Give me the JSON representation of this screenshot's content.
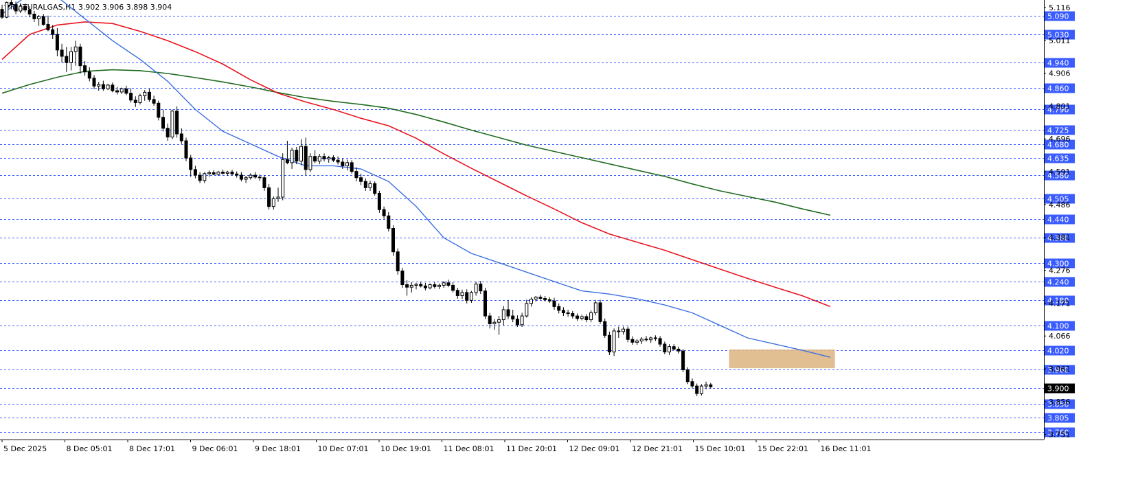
{
  "header": {
    "symbol": "NATURALGAS",
    "timeframe": "H1",
    "ohlc": "3.902 3.906 3.898 3.904",
    "ticker_text": "NATURALGAS,H1  3.902 3.906 3.898 3.904"
  },
  "colors": {
    "background": "#ffffff",
    "bullet_level": "#3a5cff",
    "candle": "#000000",
    "ma_fast": "#3b6fe0",
    "ma_mid": "#e8141e",
    "ma_slow": "#1f6b1f",
    "zone": "#deb887",
    "axis_text": "#000000",
    "price_tag_blue_bg": "#3a5cff",
    "price_tag_black_bg": "#000000"
  },
  "chart_data": {
    "type": "candlestick",
    "symbol": "NATURALGAS",
    "timeframe": "H1",
    "ylim": [
      3.735,
      5.14
    ],
    "y_ticks": [
      "5.116",
      "5.011",
      "4.906",
      "4.801",
      "4.696",
      "4.591",
      "4.486",
      "4.381",
      "4.276",
      "4.171",
      "4.066",
      "3.961",
      "3.856",
      "3.751"
    ],
    "x_ticks": [
      "5 Dec 2025",
      "8 Dec 05:01",
      "8 Dec 17:01",
      "9 Dec 06:01",
      "9 Dec 18:01",
      "10 Dec 07:01",
      "10 Dec 19:01",
      "11 Dec 08:01",
      "11 Dec 20:01",
      "12 Dec 09:01",
      "12 Dec 21:01",
      "15 Dec 10:01",
      "15 Dec 22:01",
      "16 Dec 11:01"
    ],
    "levels": [
      "5.090",
      "5.030",
      "4.940",
      "4.860",
      "4.790",
      "4.725",
      "4.680",
      "4.635",
      "4.580",
      "4.505",
      "4.440",
      "4.380",
      "4.300",
      "4.240",
      "4.180",
      "4.100",
      "4.020",
      "3.960",
      "3.900",
      "3.850",
      "3.805",
      "3.760"
    ],
    "current_price": "3.900",
    "highlight_zone": {
      "from_price": 3.963,
      "to_price": 4.023,
      "start_bar": 158,
      "end_bar": 181
    },
    "candles": [
      [
        5.11,
        5.125,
        5.08,
        5.085
      ],
      [
        5.085,
        5.135,
        5.082,
        5.132
      ],
      [
        5.132,
        5.14,
        5.11,
        5.125
      ],
      [
        5.125,
        5.135,
        5.095,
        5.105
      ],
      [
        5.105,
        5.13,
        5.098,
        5.12
      ],
      [
        5.12,
        5.128,
        5.1,
        5.108
      ],
      [
        5.108,
        5.12,
        5.085,
        5.095
      ],
      [
        5.095,
        5.105,
        5.07,
        5.08
      ],
      [
        5.08,
        5.092,
        5.058,
        5.087
      ],
      [
        5.087,
        5.095,
        5.058,
        5.062
      ],
      [
        5.062,
        5.09,
        5.04,
        5.045
      ],
      [
        5.045,
        5.06,
        5.015,
        5.03
      ],
      [
        5.03,
        5.05,
        4.96,
        4.98
      ],
      [
        4.98,
        5.0,
        4.94,
        4.96
      ],
      [
        4.96,
        4.99,
        4.91,
        4.94
      ],
      [
        4.94,
        4.99,
        4.915,
        4.975
      ],
      [
        4.975,
        5.01,
        4.93,
        4.99
      ],
      [
        4.99,
        5.0,
        4.905,
        4.93
      ],
      [
        4.93,
        4.945,
        4.898,
        4.91
      ],
      [
        4.91,
        4.925,
        4.88,
        4.89
      ],
      [
        4.89,
        4.9,
        4.855,
        4.865
      ],
      [
        4.865,
        4.878,
        4.85,
        4.87
      ],
      [
        4.87,
        4.882,
        4.85,
        4.856
      ],
      [
        4.856,
        4.872,
        4.852,
        4.868
      ],
      [
        4.868,
        4.876,
        4.845,
        4.85
      ],
      [
        4.85,
        4.862,
        4.838,
        4.846
      ],
      [
        4.846,
        4.86,
        4.84,
        4.856
      ],
      [
        4.856,
        4.866,
        4.836,
        4.842
      ],
      [
        4.842,
        4.858,
        4.812,
        4.82
      ],
      [
        4.82,
        4.832,
        4.798,
        4.812
      ],
      [
        4.812,
        4.84,
        4.806,
        4.834
      ],
      [
        4.834,
        4.852,
        4.818,
        4.845
      ],
      [
        4.845,
        4.856,
        4.815,
        4.822
      ],
      [
        4.822,
        4.834,
        4.802,
        4.81
      ],
      [
        4.81,
        4.818,
        4.755,
        4.765
      ],
      [
        4.765,
        4.79,
        4.72,
        4.73
      ],
      [
        4.73,
        4.745,
        4.69,
        4.702
      ],
      [
        4.702,
        4.79,
        4.695,
        4.785
      ],
      [
        4.785,
        4.8,
        4.7,
        4.712
      ],
      [
        4.712,
        4.73,
        4.68,
        4.69
      ],
      [
        4.69,
        4.7,
        4.625,
        4.635
      ],
      [
        4.635,
        4.645,
        4.575,
        4.598
      ],
      [
        4.598,
        4.61,
        4.57,
        4.58
      ],
      [
        4.58,
        4.59,
        4.555,
        4.563
      ],
      [
        4.563,
        4.59,
        4.555,
        4.585
      ],
      [
        4.585,
        4.595,
        4.575,
        4.588
      ],
      [
        4.588,
        4.596,
        4.58,
        4.583
      ],
      [
        4.583,
        4.594,
        4.578,
        4.59
      ],
      [
        4.59,
        4.598,
        4.582,
        4.586
      ],
      [
        4.586,
        4.594,
        4.578,
        4.59
      ],
      [
        4.59,
        4.597,
        4.58,
        4.584
      ],
      [
        4.584,
        4.592,
        4.572,
        4.58
      ],
      [
        4.58,
        4.59,
        4.56,
        4.567
      ],
      [
        4.567,
        4.578,
        4.555,
        4.572
      ],
      [
        4.572,
        4.586,
        4.566,
        4.58
      ],
      [
        4.58,
        4.59,
        4.568,
        4.574
      ],
      [
        4.574,
        4.582,
        4.562,
        4.572
      ],
      [
        4.572,
        4.58,
        4.53,
        4.54
      ],
      [
        4.54,
        4.552,
        4.47,
        4.48
      ],
      [
        4.48,
        4.512,
        4.47,
        4.505
      ],
      [
        4.505,
        4.54,
        4.495,
        4.51
      ],
      [
        4.51,
        4.65,
        4.5,
        4.63
      ],
      [
        4.63,
        4.69,
        4.615,
        4.62
      ],
      [
        4.62,
        4.668,
        4.6,
        4.66
      ],
      [
        4.66,
        4.67,
        4.615,
        4.625
      ],
      [
        4.625,
        4.695,
        4.612,
        4.672
      ],
      [
        4.672,
        4.7,
        4.58,
        4.598
      ],
      [
        4.598,
        4.65,
        4.59,
        4.64
      ],
      [
        4.64,
        4.66,
        4.618,
        4.625
      ],
      [
        4.625,
        4.648,
        4.615,
        4.64
      ],
      [
        4.64,
        4.65,
        4.624,
        4.632
      ],
      [
        4.632,
        4.642,
        4.62,
        4.636
      ],
      [
        4.636,
        4.644,
        4.622,
        4.628
      ],
      [
        4.628,
        4.64,
        4.614,
        4.622
      ],
      [
        4.622,
        4.634,
        4.6,
        4.61
      ],
      [
        4.61,
        4.63,
        4.595,
        4.62
      ],
      [
        4.62,
        4.628,
        4.585,
        4.592
      ],
      [
        4.592,
        4.605,
        4.56,
        4.572
      ],
      [
        4.572,
        4.585,
        4.548,
        4.56
      ],
      [
        4.56,
        4.57,
        4.53,
        4.54
      ],
      [
        4.54,
        4.562,
        4.53,
        4.553
      ],
      [
        4.553,
        4.56,
        4.515,
        4.522
      ],
      [
        4.522,
        4.53,
        4.46,
        4.47
      ],
      [
        4.47,
        4.48,
        4.44,
        4.45
      ],
      [
        4.45,
        4.462,
        4.4,
        4.41
      ],
      [
        4.41,
        4.42,
        4.322,
        4.335
      ],
      [
        4.335,
        4.346,
        4.262,
        4.274
      ],
      [
        4.274,
        4.284,
        4.22,
        4.23
      ],
      [
        4.23,
        4.244,
        4.195,
        4.222
      ],
      [
        4.222,
        4.238,
        4.205,
        4.228
      ],
      [
        4.228,
        4.236,
        4.215,
        4.231
      ],
      [
        4.231,
        4.24,
        4.221,
        4.226
      ],
      [
        4.226,
        4.236,
        4.212,
        4.22
      ],
      [
        4.22,
        4.234,
        4.215,
        4.23
      ],
      [
        4.23,
        4.238,
        4.218,
        4.224
      ],
      [
        4.224,
        4.234,
        4.216,
        4.228
      ],
      [
        4.228,
        4.242,
        4.22,
        4.236
      ],
      [
        4.236,
        4.246,
        4.222,
        4.228
      ],
      [
        4.228,
        4.238,
        4.205,
        4.212
      ],
      [
        4.212,
        4.22,
        4.185,
        4.195
      ],
      [
        4.195,
        4.214,
        4.185,
        4.205
      ],
      [
        4.205,
        4.215,
        4.17,
        4.18
      ],
      [
        4.18,
        4.21,
        4.172,
        4.205
      ],
      [
        4.205,
        4.24,
        4.195,
        4.232
      ],
      [
        4.232,
        4.242,
        4.2,
        4.21
      ],
      [
        4.21,
        4.22,
        4.12,
        4.13
      ],
      [
        4.13,
        4.14,
        4.09,
        4.105
      ],
      [
        4.105,
        4.12,
        4.086,
        4.11
      ],
      [
        4.11,
        4.13,
        4.07,
        4.118
      ],
      [
        4.118,
        4.162,
        4.1,
        4.15
      ],
      [
        4.15,
        4.18,
        4.12,
        4.13
      ],
      [
        4.13,
        4.15,
        4.11,
        4.12
      ],
      [
        4.12,
        4.132,
        4.095,
        4.102
      ],
      [
        4.102,
        4.14,
        4.095,
        4.13
      ],
      [
        4.13,
        4.182,
        4.125,
        4.17
      ],
      [
        4.17,
        4.19,
        4.16,
        4.184
      ],
      [
        4.184,
        4.194,
        4.176,
        4.19
      ],
      [
        4.19,
        4.198,
        4.182,
        4.186
      ],
      [
        4.186,
        4.194,
        4.176,
        4.182
      ],
      [
        4.182,
        4.19,
        4.172,
        4.178
      ],
      [
        4.178,
        4.188,
        4.15,
        4.16
      ],
      [
        4.16,
        4.17,
        4.138,
        4.148
      ],
      [
        4.148,
        4.158,
        4.13,
        4.14
      ],
      [
        4.14,
        4.15,
        4.128,
        4.138
      ],
      [
        4.138,
        4.146,
        4.122,
        4.13
      ],
      [
        4.13,
        4.138,
        4.115,
        4.122
      ],
      [
        4.122,
        4.134,
        4.116,
        4.128
      ],
      [
        4.128,
        4.136,
        4.11,
        4.118
      ],
      [
        4.118,
        4.148,
        4.11,
        4.14
      ],
      [
        4.14,
        4.18,
        4.132,
        4.172
      ],
      [
        4.172,
        4.182,
        4.105,
        4.112
      ],
      [
        4.112,
        4.122,
        4.06,
        4.068
      ],
      [
        4.068,
        4.08,
        4.005,
        4.015
      ],
      [
        4.015,
        4.09,
        4.002,
        4.082
      ],
      [
        4.082,
        4.096,
        4.06,
        4.08
      ],
      [
        4.08,
        4.096,
        4.07,
        4.088
      ],
      [
        4.088,
        4.096,
        4.046,
        4.055
      ],
      [
        4.055,
        4.065,
        4.038,
        4.046
      ],
      [
        4.046,
        4.056,
        4.038,
        4.05
      ],
      [
        4.05,
        4.062,
        4.04,
        4.056
      ],
      [
        4.056,
        4.066,
        4.048,
        4.054
      ],
      [
        4.054,
        4.064,
        4.044,
        4.06
      ],
      [
        4.06,
        4.068,
        4.05,
        4.058
      ],
      [
        4.058,
        4.066,
        4.032,
        4.04
      ],
      [
        4.04,
        4.048,
        4.008,
        4.015
      ],
      [
        4.015,
        4.04,
        4.005,
        4.032
      ],
      [
        4.032,
        4.04,
        4.02,
        4.024
      ],
      [
        4.024,
        4.032,
        4.01,
        4.018
      ],
      [
        4.018,
        4.024,
        3.95,
        3.958
      ],
      [
        3.958,
        3.966,
        3.912,
        3.92
      ],
      [
        3.92,
        3.93,
        3.9,
        3.906
      ],
      [
        3.906,
        3.914,
        3.874,
        3.882
      ],
      [
        3.882,
        3.912,
        3.876,
        3.906
      ],
      [
        3.906,
        3.92,
        3.896,
        3.91
      ],
      [
        3.91,
        3.916,
        3.898,
        3.904
      ]
    ],
    "ma_fast": [
      [
        0,
        5.095
      ],
      [
        6,
        5.16
      ],
      [
        12,
        5.15
      ],
      [
        18,
        5.08
      ],
      [
        24,
        5.01
      ],
      [
        30,
        4.95
      ],
      [
        36,
        4.88
      ],
      [
        42,
        4.79
      ],
      [
        48,
        4.72
      ],
      [
        54,
        4.68
      ],
      [
        60,
        4.64
      ],
      [
        66,
        4.61
      ],
      [
        72,
        4.61
      ],
      [
        78,
        4.6
      ],
      [
        84,
        4.56
      ],
      [
        90,
        4.48
      ],
      [
        96,
        4.38
      ],
      [
        102,
        4.33
      ],
      [
        108,
        4.3
      ],
      [
        114,
        4.27
      ],
      [
        120,
        4.24
      ],
      [
        126,
        4.21
      ],
      [
        132,
        4.2
      ],
      [
        138,
        4.185
      ],
      [
        144,
        4.165
      ],
      [
        150,
        4.14
      ],
      [
        156,
        4.1
      ],
      [
        162,
        4.06
      ],
      [
        168,
        4.04
      ],
      [
        174,
        4.02
      ],
      [
        180,
        3.998
      ]
    ],
    "ma_mid": [
      [
        0,
        4.95
      ],
      [
        6,
        5.03
      ],
      [
        12,
        5.06
      ],
      [
        18,
        5.07
      ],
      [
        24,
        5.065
      ],
      [
        30,
        5.04
      ],
      [
        36,
        5.01
      ],
      [
        42,
        4.975
      ],
      [
        48,
        4.935
      ],
      [
        54,
        4.885
      ],
      [
        60,
        4.842
      ],
      [
        66,
        4.814
      ],
      [
        72,
        4.79
      ],
      [
        78,
        4.762
      ],
      [
        84,
        4.738
      ],
      [
        90,
        4.698
      ],
      [
        96,
        4.648
      ],
      [
        102,
        4.602
      ],
      [
        108,
        4.558
      ],
      [
        114,
        4.514
      ],
      [
        120,
        4.472
      ],
      [
        126,
        4.428
      ],
      [
        132,
        4.392
      ],
      [
        138,
        4.366
      ],
      [
        144,
        4.34
      ],
      [
        150,
        4.31
      ],
      [
        156,
        4.28
      ],
      [
        162,
        4.25
      ],
      [
        168,
        4.222
      ],
      [
        174,
        4.194
      ],
      [
        180,
        4.16
      ]
    ],
    "ma_slow": [
      [
        0,
        4.842
      ],
      [
        6,
        4.87
      ],
      [
        12,
        4.893
      ],
      [
        18,
        4.912
      ],
      [
        24,
        4.917
      ],
      [
        30,
        4.914
      ],
      [
        36,
        4.905
      ],
      [
        42,
        4.892
      ],
      [
        48,
        4.878
      ],
      [
        54,
        4.862
      ],
      [
        60,
        4.844
      ],
      [
        66,
        4.828
      ],
      [
        72,
        4.816
      ],
      [
        78,
        4.806
      ],
      [
        84,
        4.794
      ],
      [
        90,
        4.774
      ],
      [
        96,
        4.75
      ],
      [
        102,
        4.724
      ],
      [
        108,
        4.7
      ],
      [
        114,
        4.676
      ],
      [
        120,
        4.656
      ],
      [
        126,
        4.636
      ],
      [
        132,
        4.616
      ],
      [
        138,
        4.596
      ],
      [
        144,
        4.576
      ],
      [
        150,
        4.552
      ],
      [
        156,
        4.53
      ],
      [
        162,
        4.512
      ],
      [
        168,
        4.494
      ],
      [
        174,
        4.472
      ],
      [
        180,
        4.452
      ]
    ]
  }
}
